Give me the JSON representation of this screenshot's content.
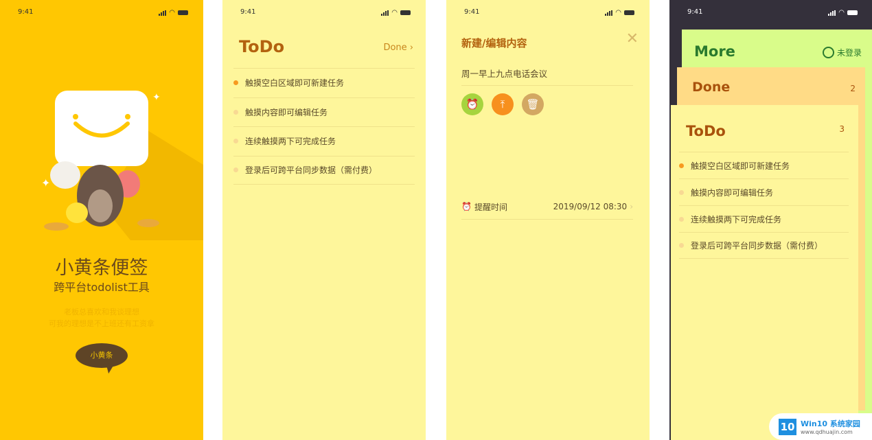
{
  "status_time": "9:41",
  "splash": {
    "title": "小黄条便签",
    "subtitle": "跨平台todolist工具",
    "quote_line1": "老板总喜欢和我谈理想",
    "quote_line2": "可我的理想是不上班还有工资拿",
    "button": "小黄条",
    "bg": "#FFC702"
  },
  "todo": {
    "title": "ToDo",
    "done_link": "Done",
    "items": [
      {
        "text": "触摸空白区域即可新建任务",
        "active": true
      },
      {
        "text": "触摸内容即可编辑任务",
        "active": false
      },
      {
        "text": "连续触摸两下可完成任务",
        "active": false
      },
      {
        "text": "登录后可跨平台同步数据（需付费）",
        "active": false
      }
    ]
  },
  "editor": {
    "title": "新建/编辑内容",
    "content": "周一早上九点电话会议",
    "buttons": [
      {
        "icon": "alarm-icon",
        "color": "#A6D43E"
      },
      {
        "icon": "pin-top-icon",
        "color": "#F7901E"
      },
      {
        "icon": "trash-icon",
        "color": "#D3A862"
      }
    ],
    "remind_label": "提醒时间",
    "remind_value": "2019/09/12  08:30"
  },
  "stack": {
    "more_title": "More",
    "login": "未登录",
    "done_title": "Done",
    "done_count": "2",
    "todo_title": "ToDo",
    "todo_count": "3",
    "items": [
      "触摸空白区域即可新建任务",
      "触摸内容即可编辑任务",
      "连续触摸两下可完成任务",
      "登录后可跨平台同步数据（需付费）"
    ]
  },
  "watermark": {
    "logo": "10",
    "name": "Win10 系统家园",
    "url": "www.qdhuajin.com"
  }
}
